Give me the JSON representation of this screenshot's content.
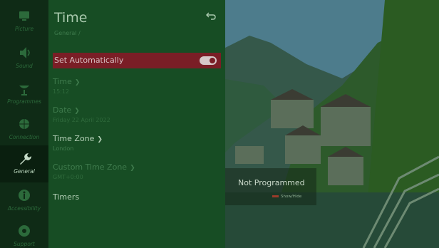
{
  "rail": {
    "items": [
      {
        "label": "Picture"
      },
      {
        "label": "Sound"
      },
      {
        "label": "Programmes"
      },
      {
        "label": "Connection"
      },
      {
        "label": "General"
      },
      {
        "label": "Accessibility"
      },
      {
        "label": "Support"
      }
    ],
    "active": "General"
  },
  "panel": {
    "title": "Time",
    "breadcrumb": "General /",
    "back_icon": "back-arrow-icon",
    "items": [
      {
        "label": "Set Automatically",
        "toggle": "on"
      },
      {
        "label": "Time",
        "value": "15:12"
      },
      {
        "label": "Date",
        "value": "Friday 22 April 2022"
      },
      {
        "label": "Time Zone",
        "value": "London"
      },
      {
        "label": "Custom Time Zone",
        "value": "GMT+0:00"
      },
      {
        "label": "Timers"
      }
    ]
  },
  "overlay": {
    "status": "Not Programmed",
    "hint": "Show/Hide"
  },
  "colors": {
    "panel_bg": "#174d24",
    "rail_bg": "#0f2b16",
    "selected_row": "#7a1e26"
  }
}
